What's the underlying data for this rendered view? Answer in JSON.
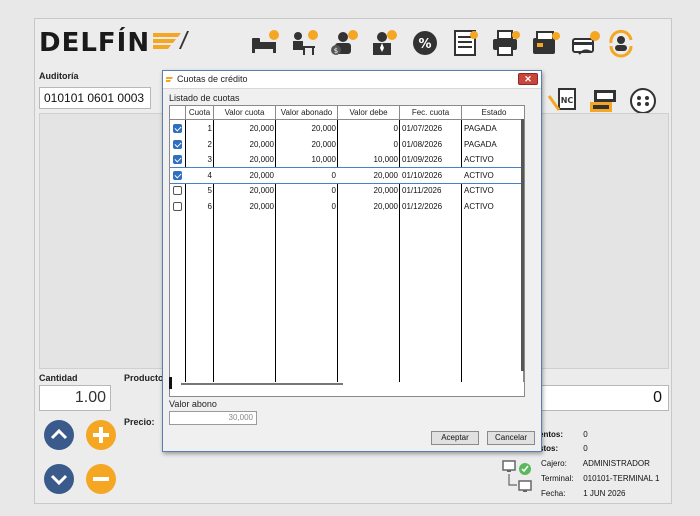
{
  "app": {
    "logo_text": "DELFÍN",
    "auditoria_label": "Auditoría",
    "auditoria_value": "010101 0601 0003",
    "cantidad_label": "Cantidad",
    "cantidad_value": "1.00",
    "producto_label": "Producto",
    "precio_label": "Precio:",
    "total_value": "0",
    "colors": {
      "accent_orange": "#f5a623",
      "accent_blue": "#2f6fc0",
      "round_button": "#3a5a8c"
    },
    "icons": [
      "bed-icon",
      "desk-worker-icon",
      "customer-payment-icon",
      "manager-icon",
      "discount-icon",
      "document-list-icon",
      "printer-icon",
      "card-reader-icon",
      "card-payment-icon",
      "user-refresh-icon"
    ],
    "right_icons": [
      "credit-note-icon",
      "cash-register-icon",
      "more-options-icon"
    ],
    "info": {
      "descuentos_label": "entos:",
      "descuentos_value": "0",
      "impuestos_label": "stos:",
      "impuestos_value": "0",
      "cajero_label": "Cajero:",
      "cajero_value": "ADMINISTRADOR",
      "terminal_label": "Terminal:",
      "terminal_value": "010101-TERMINAL 1",
      "fecha_label": "Fecha:",
      "fecha_value": "1 JUN 2026"
    }
  },
  "dialog": {
    "title": "Cuotas de crédito",
    "close_label": "✕",
    "section_label": "Listado de cuotas",
    "columns": [
      "Cuota",
      "Valor cuota",
      "Valor abonado",
      "Valor debe",
      "Fec. cuota",
      "Estado"
    ],
    "rows": [
      {
        "checked": true,
        "cuota": "1",
        "valor_cuota": "20,000",
        "valor_abonado": "20,000",
        "valor_debe": "0",
        "fecha": "01/07/2026",
        "estado": "PAGADA"
      },
      {
        "checked": true,
        "cuota": "2",
        "valor_cuota": "20,000",
        "valor_abonado": "20,000",
        "valor_debe": "0",
        "fecha": "01/08/2026",
        "estado": "PAGADA"
      },
      {
        "checked": true,
        "cuota": "3",
        "valor_cuota": "20,000",
        "valor_abonado": "10,000",
        "valor_debe": "10,000",
        "fecha": "01/09/2026",
        "estado": "ACTIVO"
      },
      {
        "checked": true,
        "cuota": "4",
        "valor_cuota": "20,000",
        "valor_abonado": "0",
        "valor_debe": "20,000",
        "fecha": "01/10/2026",
        "estado": "ACTIVO",
        "selected": true
      },
      {
        "checked": false,
        "cuota": "5",
        "valor_cuota": "20,000",
        "valor_abonado": "0",
        "valor_debe": "20,000",
        "fecha": "01/11/2026",
        "estado": "ACTIVO"
      },
      {
        "checked": false,
        "cuota": "6",
        "valor_cuota": "20,000",
        "valor_abonado": "0",
        "valor_debe": "20,000",
        "fecha": "01/12/2026",
        "estado": "ACTIVO"
      }
    ],
    "abono_label": "Valor abono",
    "abono_value": "30,000",
    "accept_label": "Aceptar",
    "cancel_label": "Cancelar"
  }
}
